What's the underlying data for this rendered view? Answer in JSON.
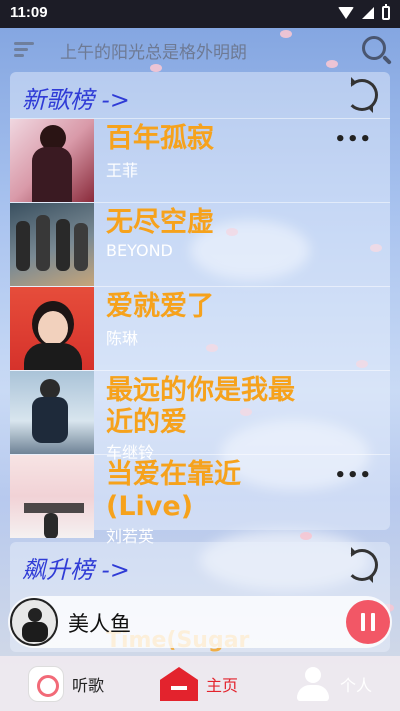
{
  "status_bar": {
    "time": "11:09"
  },
  "header": {
    "marquee": "上午的阳光总是格外明朗"
  },
  "new_chart": {
    "title": "新歌榜 ->",
    "songs": [
      {
        "name": "百年孤寂",
        "artist": "王菲"
      },
      {
        "name": "无尽空虚",
        "artist": "BEYOND"
      },
      {
        "name": "爱就爱了",
        "artist": "陈琳"
      },
      {
        "name": "最远的你是我最近的爱",
        "artist": "车继铃"
      },
      {
        "name": "当爱在靠近 (Live)",
        "artist": "刘若英"
      }
    ]
  },
  "rising_chart": {
    "title": "飙升榜 ->",
    "peek_text": "Time(Sugar"
  },
  "player": {
    "now_playing": "美人鱼"
  },
  "bottom_nav": {
    "listen": "听歌",
    "home": "主页",
    "profile": "个人"
  },
  "colors": {
    "song_title": "#f6a21c",
    "section_title": "#2f3bd6",
    "accent": "#e3232d",
    "pause": "#f25766"
  },
  "icons": [
    "menu-icon",
    "search-icon",
    "refresh-icon",
    "more-icon",
    "pause-icon",
    "music-icon",
    "home-icon",
    "person-icon"
  ]
}
